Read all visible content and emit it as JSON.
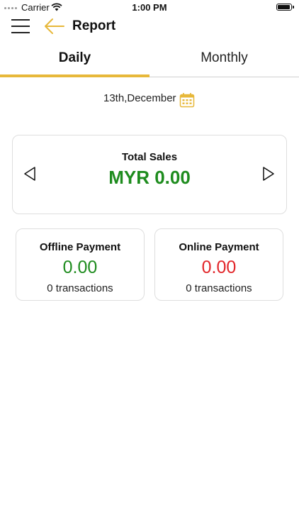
{
  "status_bar": {
    "carrier": "Carrier",
    "time": "1:00 PM",
    "battery_level": 0.9
  },
  "header": {
    "title": "Report",
    "menu_icon": "hamburger-menu-icon",
    "back_icon": "arrow-left-icon"
  },
  "tabs": [
    {
      "label": "Daily",
      "active": true
    },
    {
      "label": "Monthly",
      "active": false
    }
  ],
  "date": {
    "label": "13th,December",
    "icon": "calendar-icon"
  },
  "total_sales": {
    "label": "Total Sales",
    "value": "MYR 0.00",
    "prev_icon": "triangle-left-icon",
    "next_icon": "triangle-right-icon"
  },
  "offline_payment": {
    "title": "Offline Payment",
    "amount": "0.00",
    "transactions": "0 transactions"
  },
  "online_payment": {
    "title": "Online Payment",
    "amount": "0.00",
    "transactions": "0 transactions"
  },
  "colors": {
    "accent": "#e7b83a",
    "positive": "#1e8c1e",
    "negative": "#e2262a"
  }
}
